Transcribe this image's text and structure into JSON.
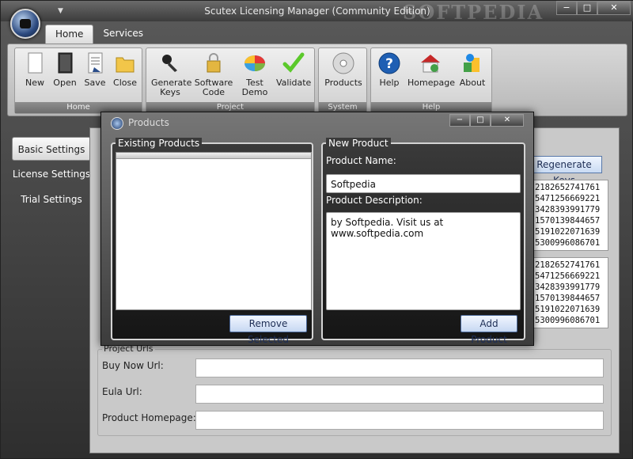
{
  "window": {
    "title": "Scutex Licensing Manager (Community Edition)",
    "watermark": "SOFTPEDIA",
    "controls": {
      "minimize": "−",
      "maximize": "□",
      "close": "✕"
    }
  },
  "tabs": [
    {
      "label": "Home"
    },
    {
      "label": "Services"
    }
  ],
  "ribbon": {
    "groups": [
      {
        "label": "Home",
        "buttons": [
          {
            "label": "New"
          },
          {
            "label": "Open"
          },
          {
            "label": "Save"
          },
          {
            "label": "Close"
          }
        ]
      },
      {
        "label": "Project",
        "buttons": [
          {
            "label": "Generate\nKeys"
          },
          {
            "label": "Software\nCode"
          },
          {
            "label": "Test\nDemo"
          },
          {
            "label": "Validate"
          }
        ]
      },
      {
        "label": "System",
        "buttons": [
          {
            "label": "Products"
          }
        ]
      },
      {
        "label": "Help",
        "buttons": [
          {
            "label": "Help"
          },
          {
            "label": "Homepage"
          },
          {
            "label": "About"
          }
        ]
      }
    ]
  },
  "sidebar": {
    "items": [
      {
        "label": "Basic Settings"
      },
      {
        "label": "License Settings"
      },
      {
        "label": "Trial Settings"
      }
    ]
  },
  "main": {
    "regenerate_label": "Regenerate Keys",
    "key_box_1": [
      "2182652741761",
      "5471256669221",
      "3428393991779",
      "1570139844657",
      "5191022071639",
      "5300996086701"
    ],
    "key_box_2": [
      "2182652741761",
      "5471256669221",
      "3428393991779",
      "1570139844657",
      "5191022071639",
      "5300996086701"
    ],
    "urls": {
      "legend": "Project Urls",
      "buy_now_label": "Buy Now Url:",
      "eula_label": "Eula Url:",
      "homepage_label": "Product Homepage:"
    }
  },
  "dialog": {
    "title": "Products",
    "controls": {
      "minimize": "−",
      "maximize": "□",
      "close": "✕"
    },
    "existing_legend": "Existing Products",
    "remove_label": "Remove Selected",
    "new_legend": "New Product",
    "name_label": "Product Name:",
    "name_value": "Softpedia",
    "desc_label": "Product Description:",
    "desc_value": "by Softpedia. Visit us at www.softpedia.com",
    "add_label": "Add Product"
  }
}
